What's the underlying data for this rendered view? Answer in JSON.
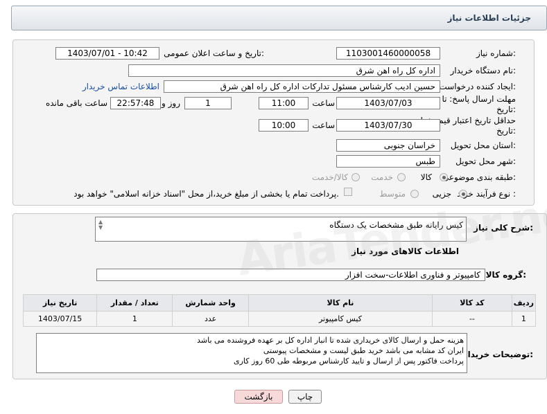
{
  "title": "جزئیات اطلاعات نیاز",
  "fields": {
    "need_number_label": "شماره نیاز:",
    "need_number": "1103001460000058",
    "announce_label": "تاریخ و ساعت اعلان عمومی:",
    "announce_value": "1403/07/01 - 10:42",
    "buyer_org_label": "نام دستگاه خریدار:",
    "buyer_org": "اداره کل راه اهن شرق",
    "creator_label": "ایجاد کننده درخواست:",
    "creator": "حسین ادیب کارشناس مسئول تدارکات اداره کل راه اهن شرق",
    "buyer_contact_link": "اطلاعات تماس خریدار",
    "reply_deadline_label": "مهلت ارسال پاسخ: تا تاریخ:",
    "reply_date": "1403/07/03",
    "time_label": "ساعت",
    "reply_time": "11:00",
    "days_value": "1",
    "days_label": "روز و",
    "remaining_time": "22:57:48",
    "remaining_label": "ساعت باقی مانده",
    "price_validity_label": "حداقل تاریخ اعتبار قیمت: تا تاریخ:",
    "price_date": "1403/07/30",
    "price_time": "10:00",
    "province_label": "استان محل تحویل:",
    "province": "خراسان جنوبی",
    "city_label": "شهر محل تحویل:",
    "city": "طبس",
    "category_label": "طبقه بندی موضوعی:",
    "category_options": [
      "کالا",
      "خدمت",
      "کالا/خدمت"
    ],
    "purchase_type_label": "نوع فرآیند خرید :",
    "purchase_options": [
      "جزیی",
      "متوسط"
    ],
    "payment_note": "پرداخت تمام یا بخشی از مبلغ خرید،از محل \"اسناد خزانه اسلامی\" خواهد بود."
  },
  "desc": {
    "general_desc_label": "شرح کلی نیاز:",
    "general_desc": "کیس رایانه طبق مشخصات   یک دستگاه",
    "goods_info_title": "اطلاعات کالاهای مورد نیاز",
    "goods_group_label": "گروه کالا:",
    "goods_group": "کامپیوتر و فناوری اطلاعات-سخت افزار"
  },
  "table": {
    "headers": [
      "ردیف",
      "کد کالا",
      "نام کالا",
      "واحد شمارش",
      "تعداد / مقدار",
      "تاریخ نیاز"
    ],
    "rows": [
      [
        "1",
        "--",
        "کیس کامپیوتر",
        "عدد",
        "1",
        "1403/07/15"
      ]
    ]
  },
  "buyer_notes": {
    "label": "توضیحات خریدار:",
    "lines": [
      "هزینه حمل و ارسال کالای خریداری شده تا انبار اداره کل بر عهده فروشنده می باشد",
      "ایران کد مشابه می باشد خرید طبق لیست و مشخصات پیوستی",
      "پرداخت فاکتور پس از ارسال و تایید کارشناس مربوطه طی 60 روز کاری"
    ]
  },
  "buttons": {
    "print": "چاپ",
    "back": "بازگشت"
  },
  "watermark": "AriaTender.neT",
  "colors": {
    "header_text": "#2a3e55",
    "link": "#1650a0",
    "back_button_bg": "#f7d9d9"
  }
}
